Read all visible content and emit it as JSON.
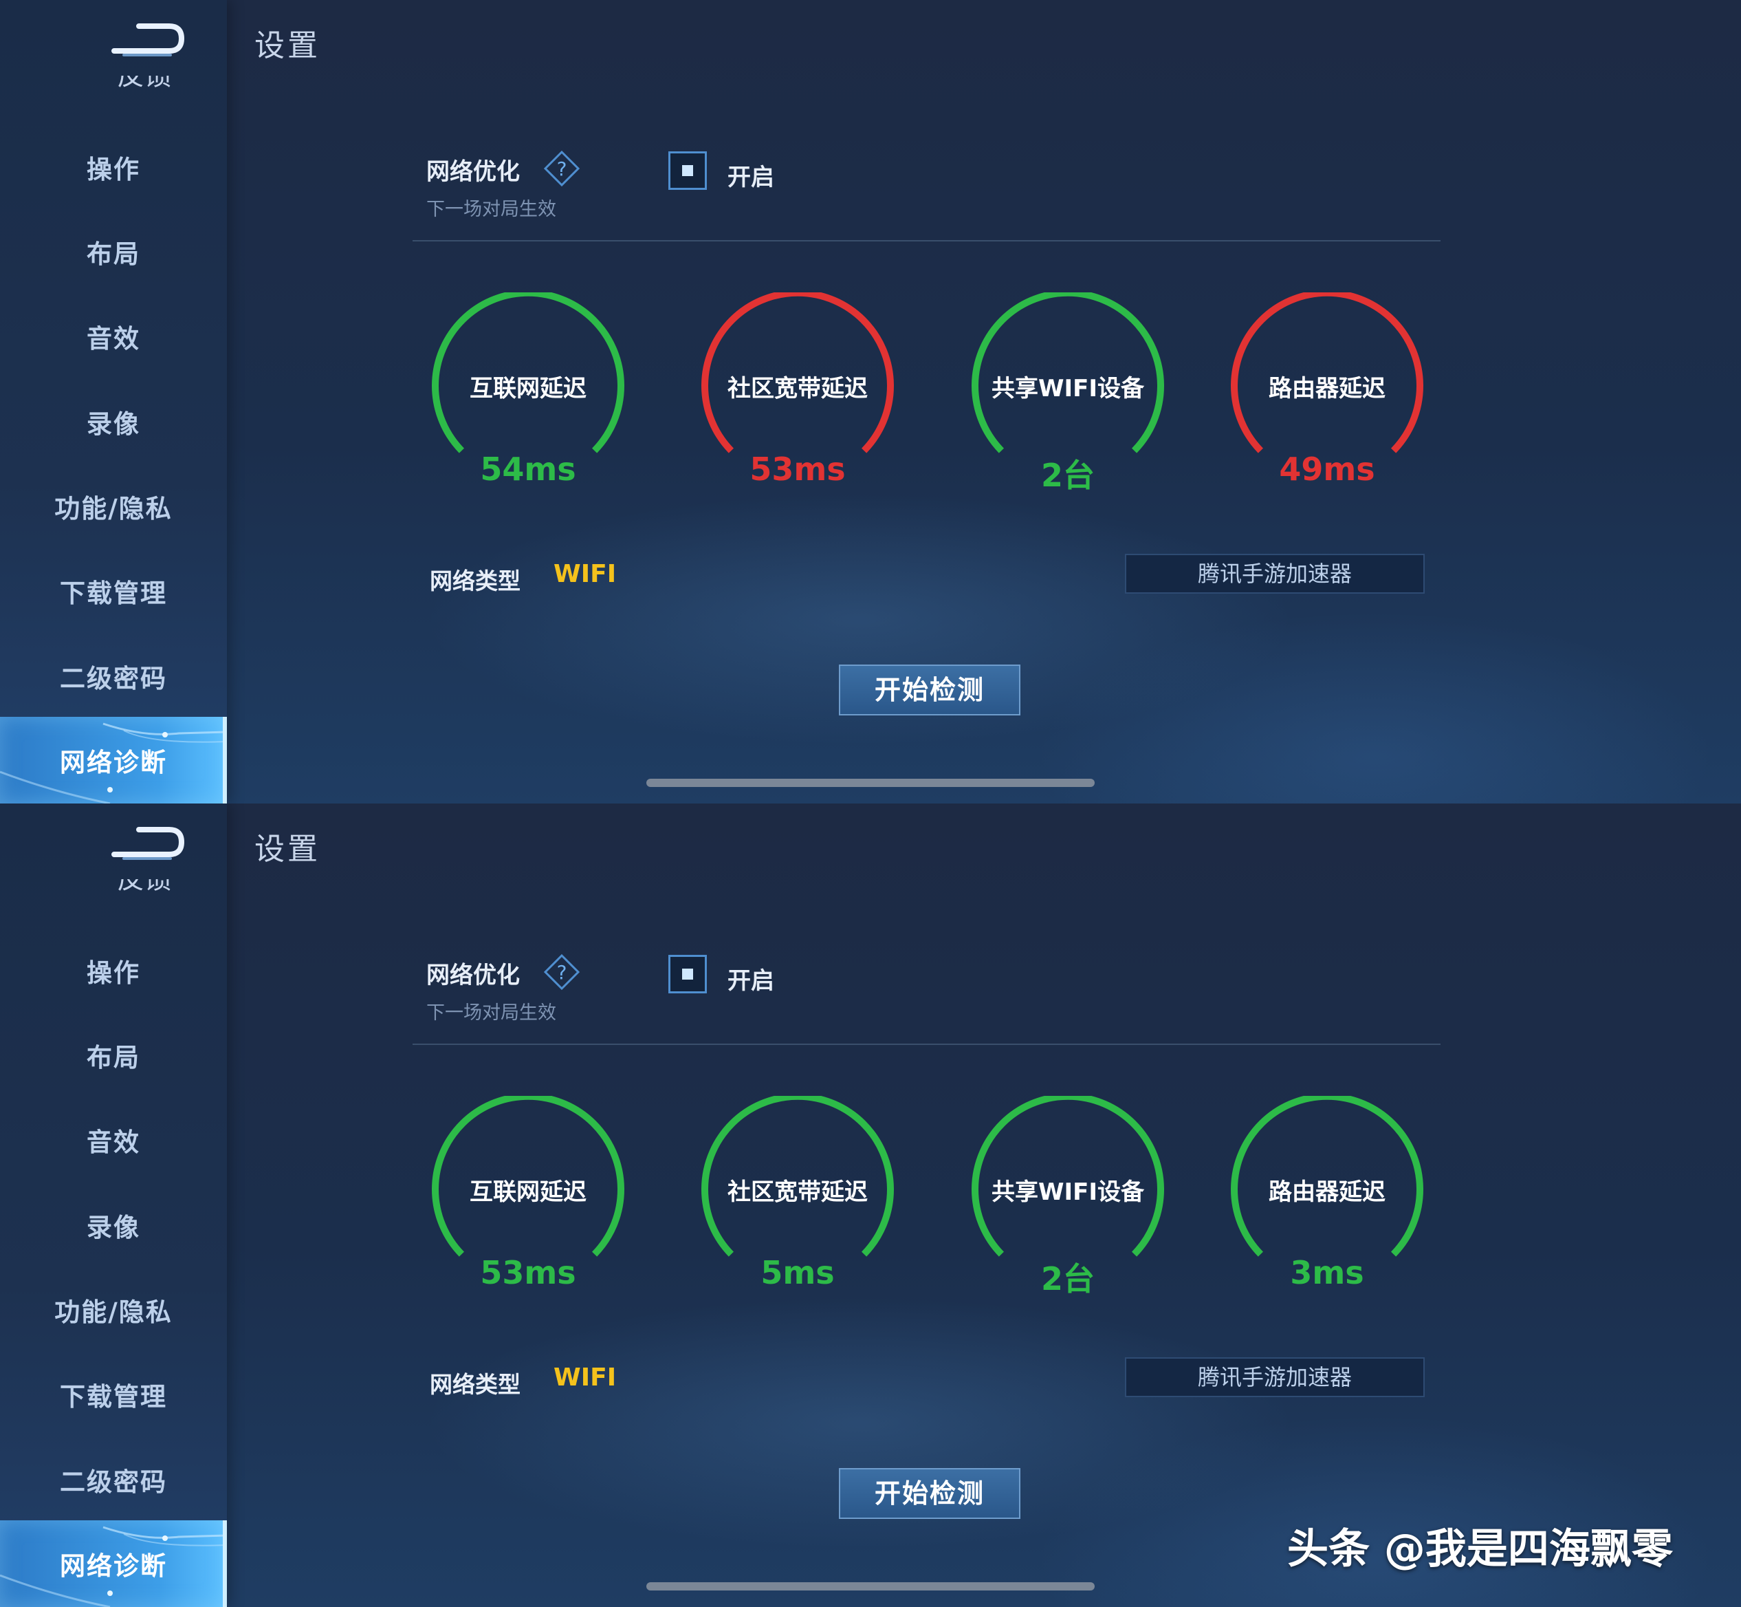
{
  "colors": {
    "green": "#2dbb48",
    "red": "#e23333",
    "wifi_yellow": "#f4c21c",
    "sidebar_active": "#3d9ee8"
  },
  "panels": [
    {
      "page_title": "设置",
      "back_icon": "back-arrow-icon",
      "sidebar_cut_item": "反馈",
      "sidebar": [
        "操作",
        "布局",
        "音效",
        "录像",
        "功能/隐私",
        "下载管理",
        "二级密码",
        "网络诊断"
      ],
      "sidebar_active": "网络诊断",
      "network_optimization": {
        "label": "网络优化",
        "help_icon": "question-diamond-icon",
        "note": "下一场对局生效",
        "checkbox_label": "开启",
        "checked": true
      },
      "gauges": [
        {
          "label": "互联网延迟",
          "value": "54ms",
          "status": "green"
        },
        {
          "label": "社区宽带延迟",
          "value": "53ms",
          "status": "red"
        },
        {
          "label": "共享WIFI设备",
          "value": "2台",
          "status": "green"
        },
        {
          "label": "路由器延迟",
          "value": "49ms",
          "status": "red"
        }
      ],
      "network_type_label": "网络类型",
      "network_type_value": "WIFI",
      "accelerator_button": "腾讯手游加速器",
      "start_button": "开始检测"
    },
    {
      "page_title": "设置",
      "back_icon": "back-arrow-icon",
      "sidebar_cut_item": "反馈",
      "sidebar": [
        "操作",
        "布局",
        "音效",
        "录像",
        "功能/隐私",
        "下载管理",
        "二级密码",
        "网络诊断"
      ],
      "sidebar_active": "网络诊断",
      "network_optimization": {
        "label": "网络优化",
        "help_icon": "question-diamond-icon",
        "note": "下一场对局生效",
        "checkbox_label": "开启",
        "checked": true
      },
      "gauges": [
        {
          "label": "互联网延迟",
          "value": "53ms",
          "status": "green"
        },
        {
          "label": "社区宽带延迟",
          "value": "5ms",
          "status": "green"
        },
        {
          "label": "共享WIFI设备",
          "value": "2台",
          "status": "green"
        },
        {
          "label": "路由器延迟",
          "value": "3ms",
          "status": "green"
        }
      ],
      "network_type_label": "网络类型",
      "network_type_value": "WIFI",
      "accelerator_button": "腾讯手游加速器",
      "start_button": "开始检测"
    }
  ],
  "watermark": "头条 @我是四海飘零"
}
